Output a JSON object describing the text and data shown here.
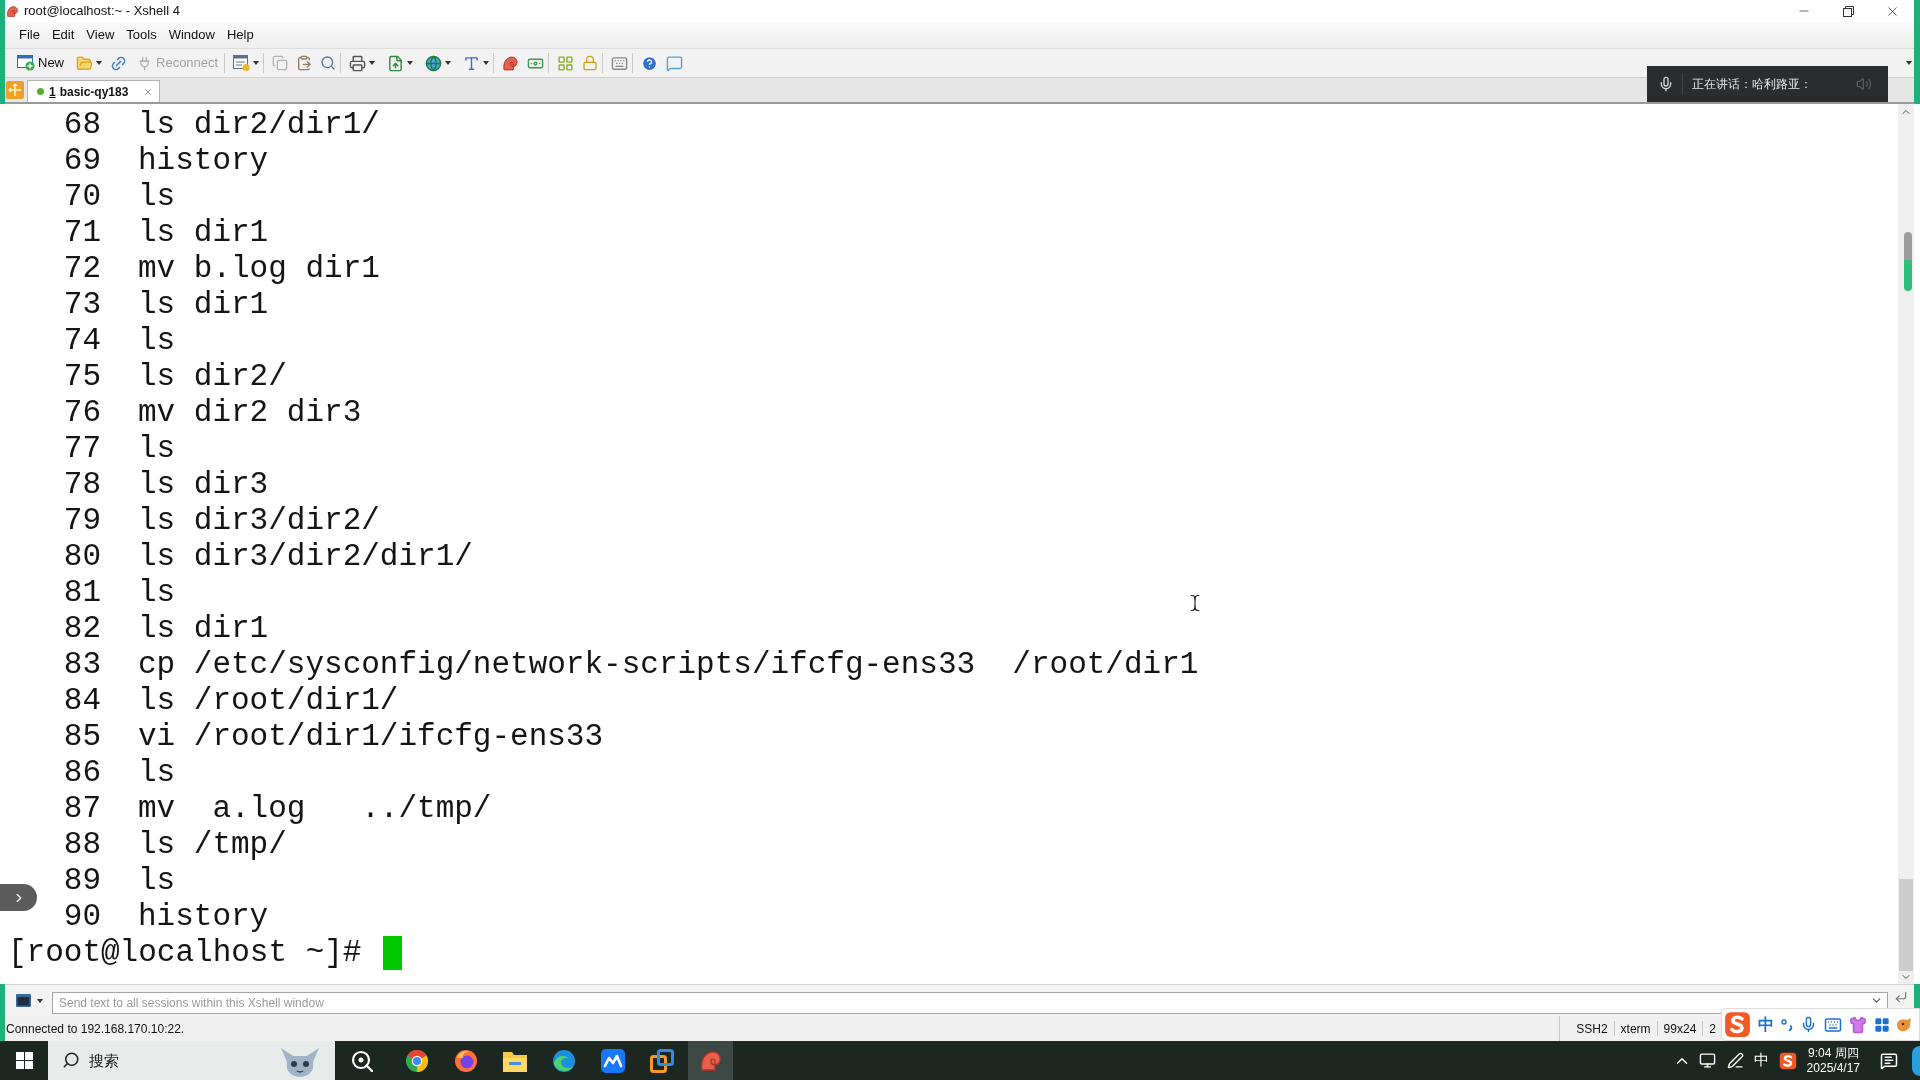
{
  "window": {
    "title": "root@localhost:~ - Xshell 4"
  },
  "menu": [
    "File",
    "Edit",
    "View",
    "Tools",
    "Window",
    "Help"
  ],
  "toolbar": {
    "new": {
      "label": "New",
      "disabled": false
    },
    "reconnect": {
      "label": "Reconnect",
      "disabled": true
    }
  },
  "tabs": [
    {
      "number": "1",
      "name": "basic-qy183",
      "selected": true,
      "connected": true
    }
  ],
  "voice_overlay": {
    "label": "正在讲话：",
    "speaker": "哈利路亚："
  },
  "terminal": {
    "history": [
      {
        "number": "68",
        "command": "ls dir2/dir1/"
      },
      {
        "number": "69",
        "command": "history"
      },
      {
        "number": "70",
        "command": "ls"
      },
      {
        "number": "71",
        "command": "ls dir1"
      },
      {
        "number": "72",
        "command": "mv b.log dir1"
      },
      {
        "number": "73",
        "command": "ls dir1"
      },
      {
        "number": "74",
        "command": "ls"
      },
      {
        "number": "75",
        "command": "ls dir2/"
      },
      {
        "number": "76",
        "command": "mv dir2 dir3"
      },
      {
        "number": "77",
        "command": "ls"
      },
      {
        "number": "78",
        "command": "ls dir3"
      },
      {
        "number": "79",
        "command": "ls dir3/dir2/"
      },
      {
        "number": "80",
        "command": "ls dir3/dir2/dir1/"
      },
      {
        "number": "81",
        "command": "ls"
      },
      {
        "number": "82",
        "command": "ls dir1"
      },
      {
        "number": "83",
        "command": "cp /etc/sysconfig/network-scripts/ifcfg-ens33  /root/dir1"
      },
      {
        "number": "84",
        "command": "ls /root/dir1/"
      },
      {
        "number": "85",
        "command": "vi /root/dir1/ifcfg-ens33"
      },
      {
        "number": "86",
        "command": "ls"
      },
      {
        "number": "87",
        "command": "mv  a.log   ../tmp/"
      },
      {
        "number": "88",
        "command": "ls /tmp/"
      },
      {
        "number": "89",
        "command": "ls"
      },
      {
        "number": "90",
        "command": "history"
      }
    ],
    "prompt": "[root@localhost ~]#"
  },
  "send_bar": {
    "placeholder": "Send text to all sessions within this Xshell window"
  },
  "status_bar": {
    "connection": "Connected to 192.168.170.10:22.",
    "items": [
      "SSH2",
      "xterm",
      "99x24",
      "2"
    ]
  },
  "ime_toolbar": {
    "mode": "中"
  },
  "taskbar": {
    "search": {
      "placeholder": "搜索"
    },
    "apps": [
      {
        "selected": false
      },
      {
        "selected": false
      },
      {
        "selected": false
      },
      {
        "selected": false
      },
      {
        "selected": false
      },
      {
        "selected": false
      },
      {
        "selected": false
      },
      {
        "selected": true
      }
    ],
    "tray_ime": "中",
    "time": "9:04 周四",
    "date": "2025/4/17"
  }
}
